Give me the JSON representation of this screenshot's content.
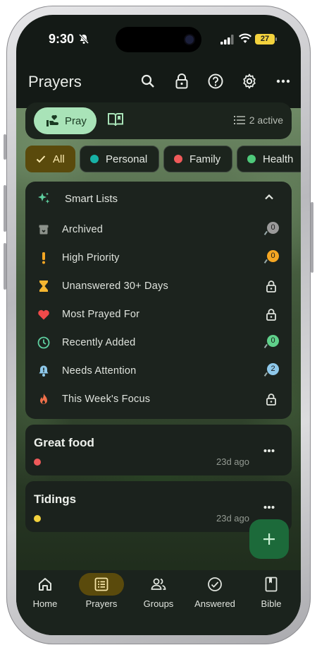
{
  "status_bar": {
    "time": "9:30",
    "battery": "27"
  },
  "app_bar": {
    "title": "Prayers",
    "icons": [
      "search-icon",
      "lock-icon",
      "help-icon",
      "gear-icon",
      "more-icon"
    ]
  },
  "mode_bar": {
    "pray_label": "Pray",
    "active_count": "2 active"
  },
  "chips": [
    {
      "label": "All",
      "selected": true
    },
    {
      "label": "Personal",
      "color": "#17b2a6"
    },
    {
      "label": "Family",
      "color": "#ef5a5a"
    },
    {
      "label": "Health",
      "color": "#4ec97a"
    }
  ],
  "smart_lists": {
    "title": "Smart Lists",
    "items": [
      {
        "label": "Archived",
        "icon": "archive-icon",
        "badge": "0",
        "badge_color": "#9a9a9a"
      },
      {
        "label": "High Priority",
        "icon": "exclamation-icon",
        "badge": "0",
        "badge_color": "#f5a623"
      },
      {
        "label": "Unanswered 30+ Days",
        "icon": "hourglass-icon",
        "locked": true
      },
      {
        "label": "Most Prayed For",
        "icon": "heart-icon",
        "locked": true
      },
      {
        "label": "Recently Added",
        "icon": "clock-icon",
        "badge": "0",
        "badge_color": "#5fd08a"
      },
      {
        "label": "Needs Attention",
        "icon": "bell-alert-icon",
        "badge": "2",
        "badge_color": "#8ec8ea"
      },
      {
        "label": "This Week's Focus",
        "icon": "flame-icon",
        "locked": true
      }
    ]
  },
  "prayers": [
    {
      "title": "Great food",
      "time": "23d ago",
      "dot_color": "#ef5a5a"
    },
    {
      "title": "Tidings",
      "time": "23d ago",
      "dot_color": "#f3d23d"
    }
  ],
  "bottom_nav": [
    {
      "label": "Home",
      "icon": "home-icon"
    },
    {
      "label": "Prayers",
      "icon": "list-icon",
      "active": true
    },
    {
      "label": "Groups",
      "icon": "groups-icon"
    },
    {
      "label": "Answered",
      "icon": "check-circle-icon"
    },
    {
      "label": "Bible",
      "icon": "book-icon"
    }
  ]
}
